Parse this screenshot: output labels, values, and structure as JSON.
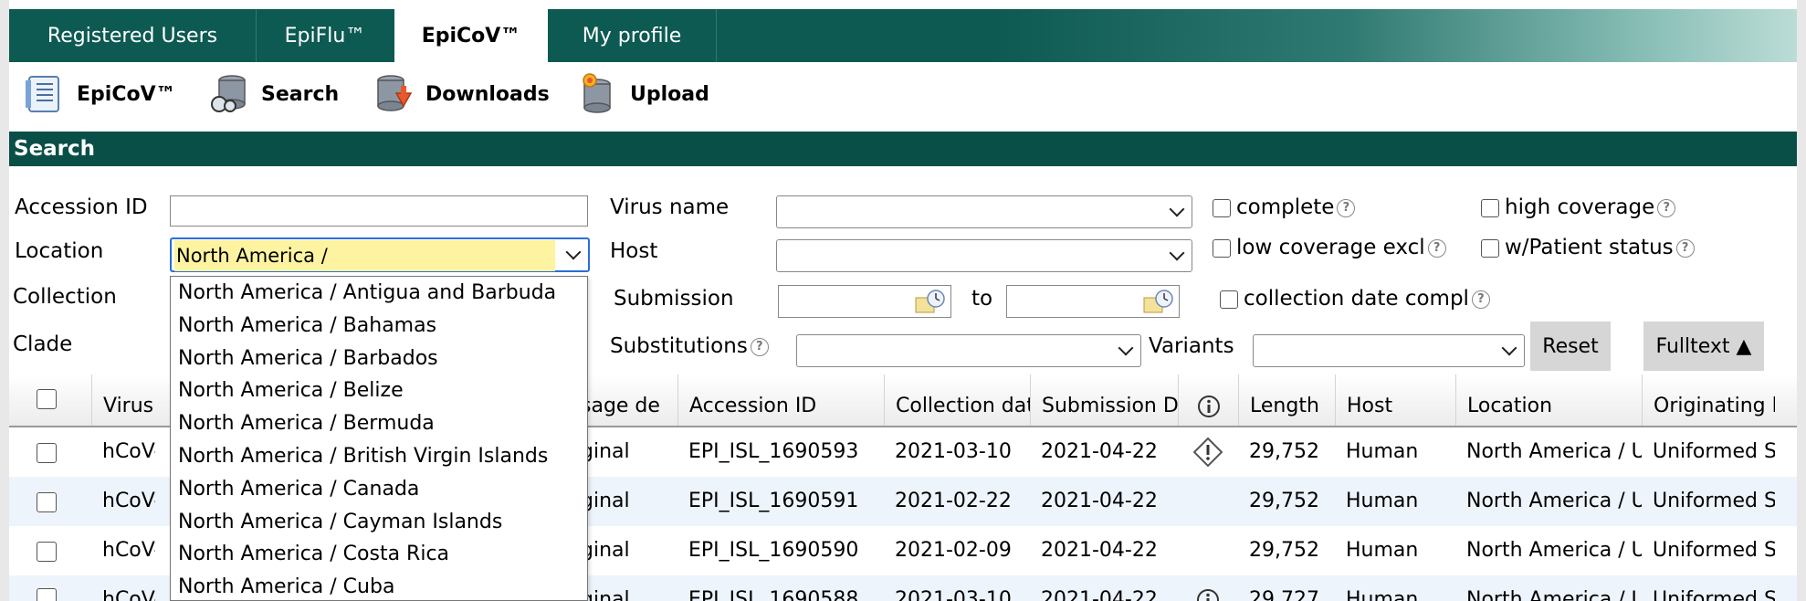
{
  "top_tabs": [
    "Registered Users",
    "EpiFlu™",
    "EpiCoV™",
    "My profile"
  ],
  "active_tab": "EpiCoV™",
  "toolbar": {
    "epicov": "EpiCoV™",
    "search": "Search",
    "downloads": "Downloads",
    "upload": "Upload"
  },
  "section_title": "Search",
  "form": {
    "accession_label": "Accession ID",
    "accession_value": "",
    "virus_name_label": "Virus name",
    "location_label": "Location",
    "location_value": "North America /",
    "host_label": "Host",
    "collection_label": "Collection",
    "submission_label": "Submission",
    "to_label": "to",
    "clade_label": "Clade",
    "substitutions_label": "Substitutions",
    "variants_label": "Variants",
    "complete_label": "complete",
    "high_coverage_label": "high coverage",
    "low_coverage_label": "low coverage excl",
    "patient_status_label": "w/Patient status",
    "collection_date_complete_label": "collection date compl",
    "help_glyph": "?",
    "reset_label": "Reset",
    "fulltext_label": "Fulltext ▲"
  },
  "location_options": [
    "North America / Antigua and Barbuda",
    "North America / Bahamas",
    "North America / Barbados",
    "North America / Belize",
    "North America / Bermuda",
    "North America / British Virgin Islands",
    "North America / Canada",
    "North America / Cayman Islands",
    "North America / Costa Rica",
    "North America / Cuba"
  ],
  "table": {
    "columns": [
      "Virus n",
      "sage de",
      "Accession ID",
      "Collection dat",
      "Submission D",
      "Length",
      "Host",
      "Location",
      "Originating l"
    ],
    "rows": [
      {
        "virus": "hCoV-",
        "passage": "ginal",
        "accession": "EPI_ISL_1690593",
        "collection": "2021-03-10",
        "submission": "2021-04-22",
        "flag": "warning",
        "length": "29,752",
        "host": "Human",
        "location": "North America / U",
        "originating": "Uniformed S"
      },
      {
        "virus": "hCoV-",
        "passage": "ginal",
        "accession": "EPI_ISL_1690591",
        "collection": "2021-02-22",
        "submission": "2021-04-22",
        "flag": "",
        "length": "29,752",
        "host": "Human",
        "location": "North America / U",
        "originating": "Uniformed S"
      },
      {
        "virus": "hCoV-",
        "passage": "ginal",
        "accession": "EPI_ISL_1690590",
        "collection": "2021-02-09",
        "submission": "2021-04-22",
        "flag": "",
        "length": "29,752",
        "host": "Human",
        "location": "North America / U",
        "originating": "Uniformed S"
      },
      {
        "virus": "hCoV-",
        "passage": "ginal",
        "accession": "EPI_ISL_1690588",
        "collection": "2021-03-10",
        "submission": "2021-04-22",
        "flag": "info",
        "length": "29,727",
        "host": "Human",
        "location": "North America / U",
        "originating": "Uniformed S"
      }
    ]
  },
  "colors": {
    "header_teal": "#0a4f47",
    "tab_teal": "#0d5a52",
    "focus_blue": "#2a6ed8",
    "highlight_yellow": "#fef3a0",
    "row_alt": "#eef4fb"
  }
}
